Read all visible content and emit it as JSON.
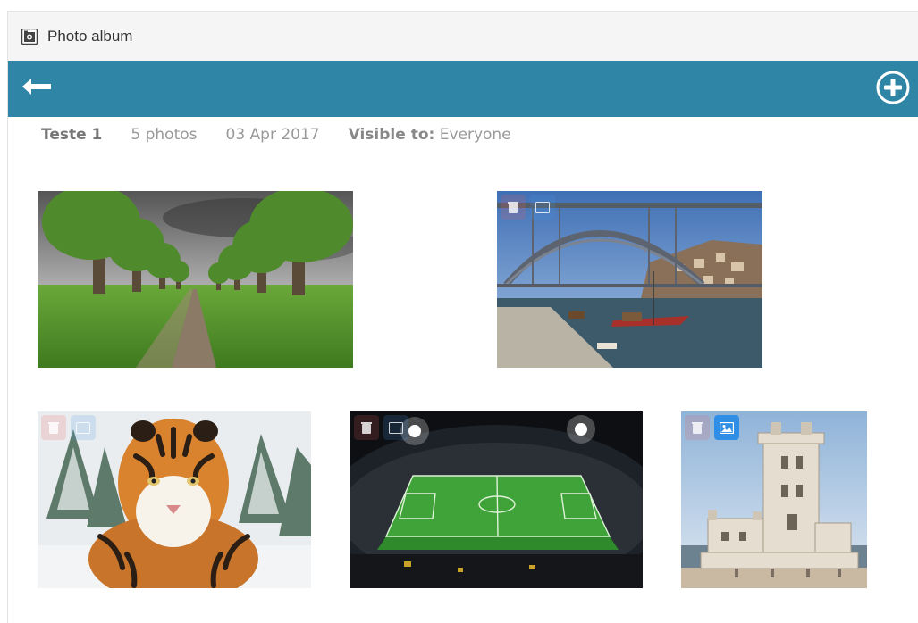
{
  "window": {
    "title": "Photo album"
  },
  "icons": {
    "app": "camera-icon",
    "back": "arrow-left-icon",
    "add": "plus-circle-icon",
    "delete": "trash-icon",
    "set_cover": "image-icon"
  },
  "colors": {
    "toolbar": "#2f85a5",
    "cover_button": "#2f8ee6",
    "delete_button": "#e76060"
  },
  "album": {
    "name": "Teste 1",
    "photo_count": "5 photos",
    "date": "03 Apr 2017",
    "visibility_label": "Visible to:",
    "visibility_value": "Everyone"
  },
  "photos": [
    {
      "subject": "tree-lined path",
      "is_cover": false
    },
    {
      "subject": "arch bridge over river",
      "is_cover": false
    },
    {
      "subject": "tiger in snow",
      "is_cover": false
    },
    {
      "subject": "football stadium at night",
      "is_cover": false
    },
    {
      "subject": "stone tower by the sea",
      "is_cover": true
    }
  ]
}
